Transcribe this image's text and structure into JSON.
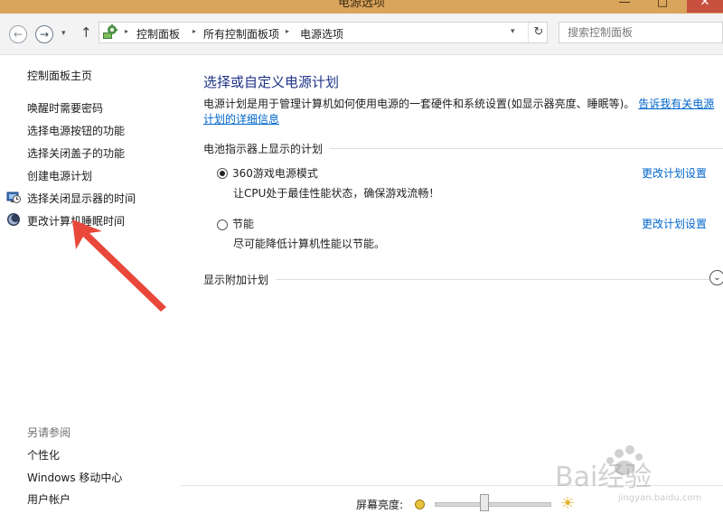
{
  "window": {
    "title": "电源选项",
    "controls": {
      "minimize": "—",
      "maximize": "□",
      "close": "✕"
    }
  },
  "nav": {
    "back_glyph": "←",
    "forward_glyph": "→",
    "dropdown_glyph": "▾",
    "up_glyph": "↑",
    "refresh_glyph": "↻",
    "breadcrumb_sep": "▸",
    "breadcrumbs": [
      "控制面板",
      "所有控制面板项",
      "电源选项"
    ],
    "search_placeholder": "搜索控制面板"
  },
  "sidebar": {
    "home": "控制面板主页",
    "items": [
      {
        "label": "唤醒时需要密码",
        "icon": null
      },
      {
        "label": "选择电源按钮的功能",
        "icon": null
      },
      {
        "label": "选择关闭盖子的功能",
        "icon": null
      },
      {
        "label": "创建电源计划",
        "icon": null
      },
      {
        "label": "选择关闭显示器的时间",
        "icon": "monitor-clock-icon"
      },
      {
        "label": "更改计算机睡眠时间",
        "icon": "moon-sleep-icon"
      }
    ],
    "see_also_title": "另请参阅",
    "see_also": [
      "个性化",
      "Windows 移动中心",
      "用户帐户"
    ]
  },
  "main": {
    "title": "选择或自定义电源计划",
    "description": "电源计划是用于管理计算机如何使用电源的一套硬件和系统设置(如显示器亮度、睡眠等)。",
    "description_link": "告诉我有关电源计划的详细信息",
    "battery_section": "电池指示器上显示的计划",
    "plans": [
      {
        "name": "360游戏电源模式",
        "desc": "让CPU处于最佳性能状态，确保游戏流畅！",
        "selected": true,
        "change_link": "更改计划设置"
      },
      {
        "name": "节能",
        "desc": "尽可能降低计算机性能以节能。",
        "selected": false,
        "change_link": "更改计划设置"
      }
    ],
    "additional_section": "显示附加计划",
    "expand_glyph": "⌄"
  },
  "bottom": {
    "brightness_label": "屏幕亮度:",
    "brightness_level": 0.43,
    "bright_icon": "☀"
  },
  "overlays": {
    "annotation_arrow_color": "#e8473a",
    "watermark_text": "Bai经验",
    "watermark_sub": "jingyan.baidu.com"
  }
}
